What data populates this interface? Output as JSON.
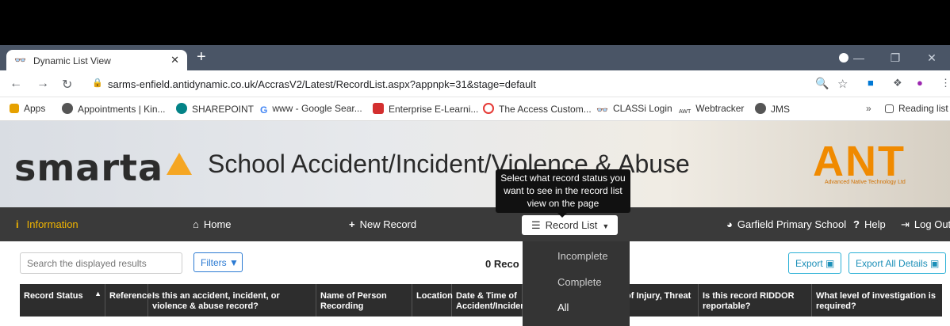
{
  "browser": {
    "tab_title": "Dynamic List View",
    "url": "sarms-enfield.antidynamic.co.uk/AccrasV2/Latest/RecordList.aspx?appnpk=31&stage=default",
    "bookmarks": [
      "Apps",
      "Appointments | Kin...",
      "SHAREPOINT",
      "www - Google Sear...",
      "Enterprise E-Learni...",
      "The Access Custom...",
      "CLASSi Login",
      "Webtracker",
      "JMS"
    ],
    "reading_list": "Reading list"
  },
  "banner": {
    "logo": "smarta",
    "title": "School Accident/Incident/Violence & Abuse",
    "ant_logo": "ANT",
    "ant_sub": "Advanced Native Technology Ltd"
  },
  "toolbar": {
    "information": "Information",
    "home": "Home",
    "new_record": "New Record",
    "record_list": "Record List",
    "school": "Garfield Primary School",
    "help": "Help",
    "logout": "Log Out"
  },
  "tooltip": {
    "line1": "Select what record status you",
    "line2": "want to see in the record list",
    "line3": "view on the page"
  },
  "dropdown": {
    "options": [
      "Incomplete",
      "Complete",
      "All"
    ]
  },
  "list": {
    "search_placeholder": "Search the displayed results",
    "filters": "Filters",
    "count": "0 Reco",
    "export": "Export",
    "export_all": "Export All Details"
  },
  "table": {
    "headers": [
      "Record Status",
      "Reference",
      "Is this an accident, incident, or violence & abuse record?",
      "Name of Person Recording",
      "Location",
      "Date & Time of Accident/Incident",
      "of Injury, Threat",
      "Is this record RIDDOR reportable?",
      "What level of investigation is required?"
    ]
  },
  "colors": {
    "toolbar_bg": "#3a3a3a",
    "accent_info": "#f0b400",
    "link_blue": "#2c7bd3",
    "ant_orange": "#f08a00"
  }
}
